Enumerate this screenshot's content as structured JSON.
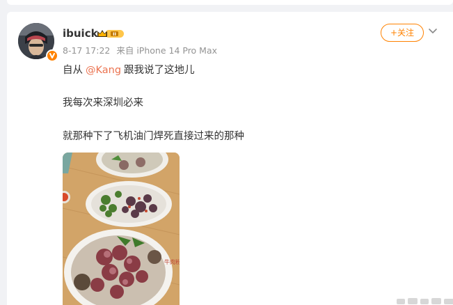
{
  "post": {
    "username": "ibuick",
    "timestamp": "8-17 17:22",
    "source": "来自 iPhone 14 Pro Max",
    "follow_label": "+关注",
    "text_line1_prefix": "自从",
    "mention": "@Kang",
    "text_line1_suffix": "跟我说了这地儿",
    "text_line2": "我每次来深圳必来",
    "text_line3": "就那种下了飞机油门焊死直接过来的那种",
    "photo_alt": "Noodle soup with sliced beef and a plate of beef with herbs",
    "badge_icon": "vip-crown-badge",
    "verify_icon": "verified-badge",
    "more_icon": "chevron-down",
    "photo_stamp": "牛肉粉"
  },
  "colors": {
    "accent": "#ff8200",
    "mention": "#eb7350",
    "text": "#333333",
    "meta": "#939393",
    "page_bg": "#f1f2f5"
  }
}
